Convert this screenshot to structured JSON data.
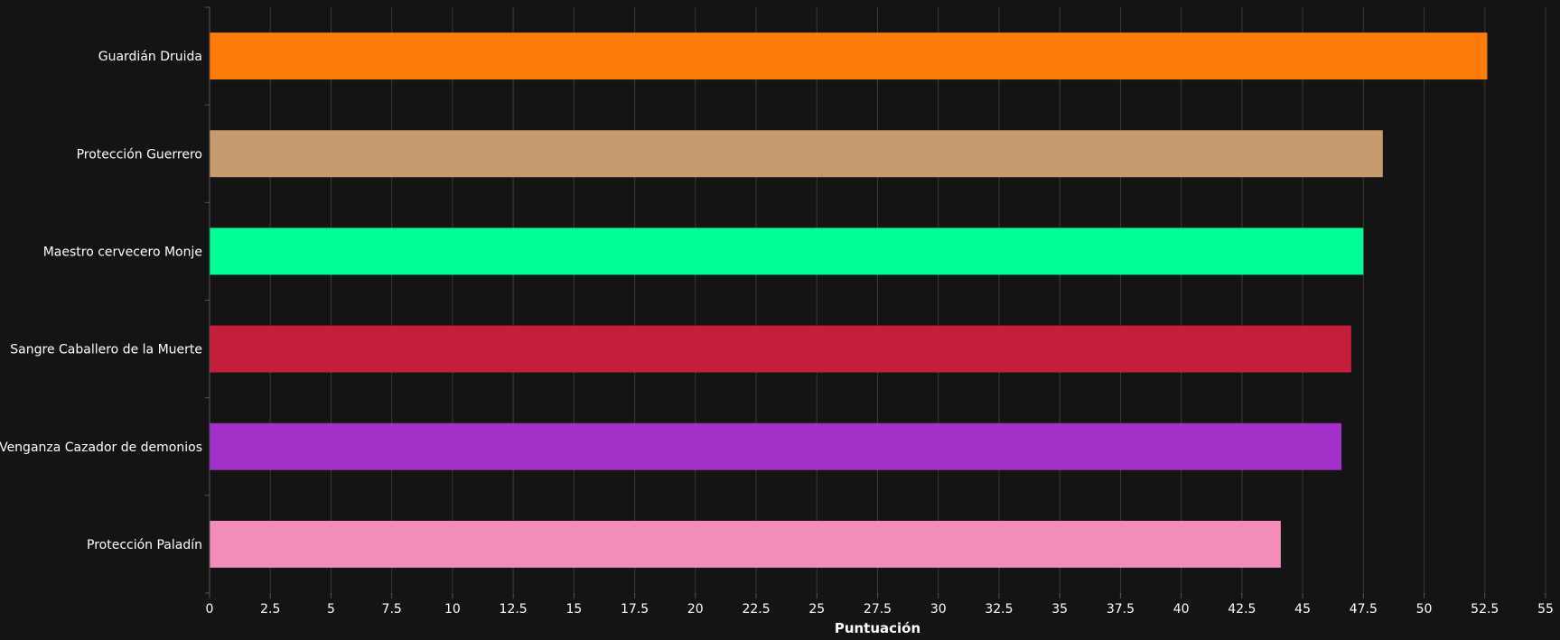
{
  "chart_data": {
    "type": "bar",
    "orientation": "horizontal",
    "categories": [
      "Guardián Druida",
      "Protección Guerrero",
      "Maestro cervecero Monje",
      "Sangre Caballero de la Muerte",
      "Venganza Cazador de demonios",
      "Protección Paladín"
    ],
    "values": [
      52.6,
      48.3,
      47.5,
      47.0,
      46.6,
      44.1
    ],
    "colors": [
      "#FF7C0A",
      "#C69B6D",
      "#00FF98",
      "#C41E3A",
      "#A330C9",
      "#F48CBA"
    ],
    "xlabel": "Puntuación",
    "ylabel": "",
    "xlim": [
      0,
      55
    ],
    "xticks": [
      "0",
      "2.5",
      "5",
      "7.5",
      "10",
      "12.5",
      "15",
      "17.5",
      "20",
      "22.5",
      "25",
      "27.5",
      "30",
      "32.5",
      "35",
      "37.5",
      "40",
      "42.5",
      "45",
      "47.5",
      "50",
      "52.5",
      "55"
    ],
    "grid": true,
    "background": "#141414"
  }
}
